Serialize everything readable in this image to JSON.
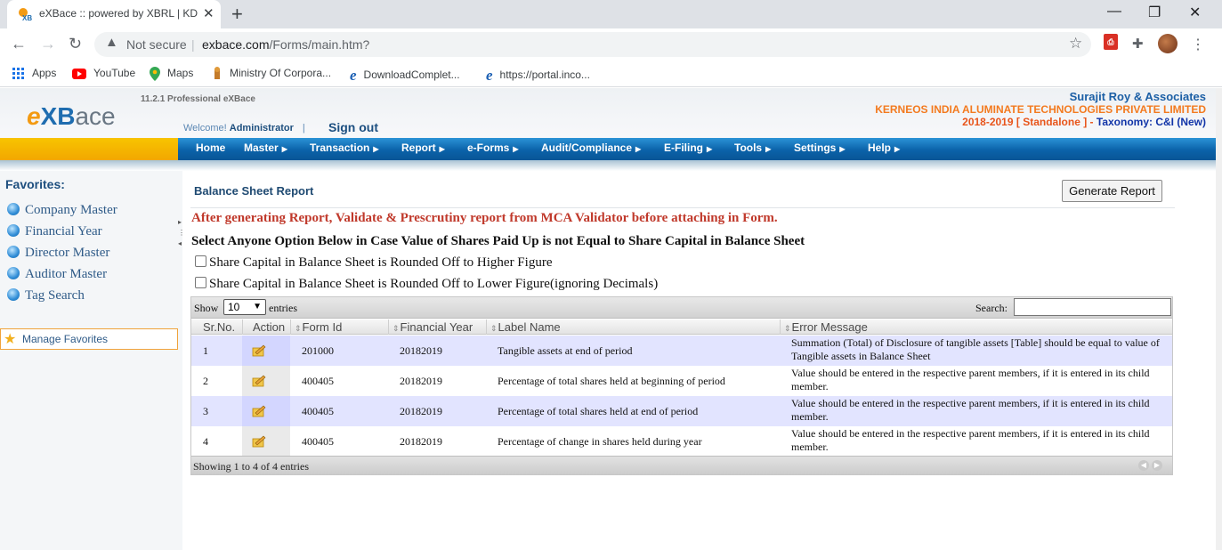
{
  "browser": {
    "tab_title": "eXBace :: powered by XBRL | KDK",
    "url_security": "Not secure",
    "url_host": "exbace.com",
    "url_path": "/Forms/main.htm?",
    "bookmarks": [
      {
        "label": "Apps",
        "icon": "apps-grid-icon"
      },
      {
        "label": "YouTube",
        "icon": "youtube-icon"
      },
      {
        "label": "Maps",
        "icon": "maps-pin-icon"
      },
      {
        "label": "Ministry Of Corpora...",
        "icon": "emblem-icon"
      },
      {
        "label": "DownloadComplet...",
        "icon": "ie-e-icon"
      },
      {
        "label": "https://portal.inco...",
        "icon": "ie-e-icon"
      }
    ]
  },
  "header": {
    "logo_e": "e",
    "logo_xb": "XB",
    "logo_ace": "ace",
    "version": "11.2.1 Professional eXBace",
    "welcome_label": "Welcome!",
    "user": "Administrator",
    "separator": "|",
    "signout": "Sign out",
    "firm": "Surajit Roy & Associates",
    "company": "KERNEOS INDIA ALUMINATE TECHNOLOGIES PRIVATE LIMITED",
    "year": "2018-2019 [ Standalone ] -",
    "taxonomy": "Taxonomy: C&I (New)"
  },
  "menu": [
    "Home",
    "Master",
    "Transaction",
    "Report",
    "e-Forms",
    "Audit/Compliance",
    "E-Filing",
    "Tools",
    "Settings",
    "Help"
  ],
  "sidebar": {
    "title": "Favorites:",
    "items": [
      "Company Master",
      "Financial Year",
      "Director Master",
      "Auditor Master",
      "Tag Search"
    ],
    "manage": "Manage Favorites"
  },
  "main": {
    "title": "Balance Sheet Report",
    "generate_button": "Generate Report",
    "warning": "After generating Report, Validate & Prescrutiny report from MCA Validator before attaching in Form.",
    "instruction": "Select Anyone Option Below in Case Value of Shares Paid Up is not Equal to Share Capital in Balance Sheet",
    "options": [
      "Share Capital in Balance Sheet is Rounded Off to Higher Figure",
      "Share Capital in Balance Sheet is Rounded Off to Lower Figure(ignoring Decimals)"
    ]
  },
  "grid": {
    "show_label": "Show",
    "page_size": "10",
    "entries_label": "entries",
    "search_label": "Search:",
    "search_value": "",
    "columns": [
      "Sr.No.",
      "Action",
      "Form Id",
      "Financial Year",
      "Label Name",
      "Error Message"
    ],
    "rows": [
      {
        "sr": "1",
        "form_id": "201000",
        "year": "20182019",
        "label": "Tangible assets at end of period",
        "error": "Summation (Total) of Disclosure of tangible assets [Table] should be equal to value of Tangible assets in Balance Sheet"
      },
      {
        "sr": "2",
        "form_id": "400405",
        "year": "20182019",
        "label": "Percentage of total shares held at beginning of period",
        "error": "Value should be entered in the respective parent members, if it is entered in its child member."
      },
      {
        "sr": "3",
        "form_id": "400405",
        "year": "20182019",
        "label": "Percentage of total shares held at end of period",
        "error": "Value should be entered in the respective parent members, if it is entered in its child member."
      },
      {
        "sr": "4",
        "form_id": "400405",
        "year": "20182019",
        "label": "Percentage of change in shares held during year",
        "error": "Value should be entered in the respective parent members, if it is entered in its child member."
      }
    ],
    "footer": "Showing 1 to 4 of 4 entries"
  }
}
